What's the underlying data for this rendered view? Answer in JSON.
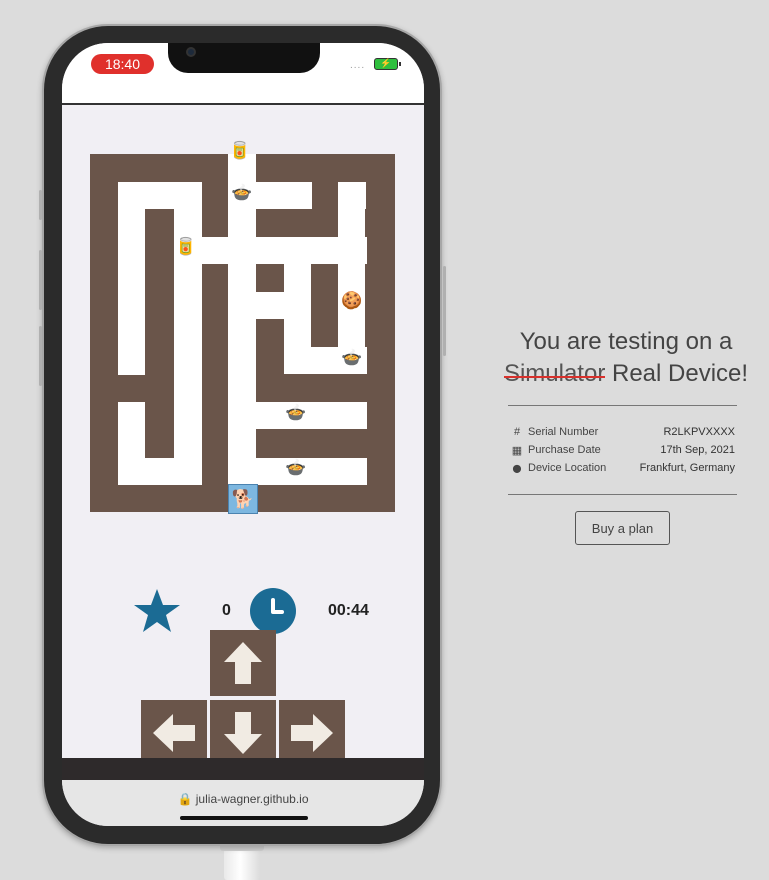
{
  "device": {
    "status_time": "18:40",
    "signal": "....",
    "battery_icon": "battery-charging-icon"
  },
  "game": {
    "score": "0",
    "timer": "00:44",
    "items": {
      "food_bag_top": "🥫",
      "bowl_1": "🍲",
      "can": "🥫",
      "treat_box": "🍪",
      "bowl_2": "🍲",
      "bowl_3": "🍲",
      "bowl_4": "🍲",
      "dog": "🐕"
    },
    "controls": [
      "up",
      "left",
      "down",
      "right"
    ]
  },
  "browser": {
    "url": "julia-wagner.github.io"
  },
  "panel": {
    "title_line1": "You are testing on a",
    "title_strike": "Simulator",
    "title_rest": "Real Device!",
    "rows": [
      {
        "icon": "#",
        "label": "Serial Number",
        "value": "R2LKPVXXXX"
      },
      {
        "icon": "▦",
        "label": "Purchase Date",
        "value": "17th Sep, 2021"
      },
      {
        "icon": "⬤",
        "label": "Device Location",
        "value": "Frankfurt, Germany"
      }
    ],
    "buy_label": "Buy a plan"
  },
  "colors": {
    "maze_wall": "#6a554a",
    "accent_blue": "#1b6b94",
    "strike_red": "#d9312c",
    "time_pill": "#e0302c"
  }
}
